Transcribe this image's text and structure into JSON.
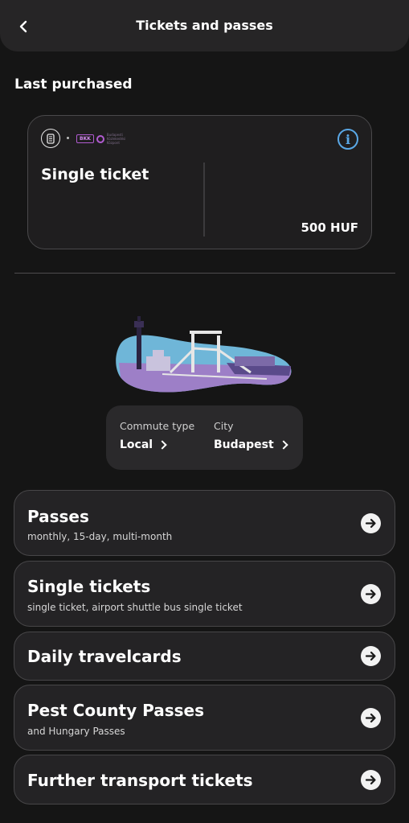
{
  "header": {
    "title": "Tickets and passes"
  },
  "last_purchased": {
    "section_title": "Last purchased",
    "ticket_name": "Single ticket",
    "price": "500 HUF",
    "operator_logo_text": "BKK",
    "operator_logo_subtext": "Budapesti Közlekedési Központ"
  },
  "selector": {
    "commute_label": "Commute type",
    "commute_value": "Local",
    "city_label": "City",
    "city_value": "Budapest"
  },
  "menu": [
    {
      "title": "Passes",
      "subtitle": "monthly, 15-day, multi-month"
    },
    {
      "title": "Single tickets",
      "subtitle": "single ticket, airport shuttle bus single ticket"
    },
    {
      "title": "Daily travelcards",
      "subtitle": ""
    },
    {
      "title": "Pest County Passes",
      "subtitle": "and Hungary Passes"
    },
    {
      "title": "Further transport tickets",
      "subtitle": ""
    }
  ],
  "colors": {
    "info_accent": "#5aa8e6",
    "bkk_purple": "#b05bd0",
    "background": "#151515"
  }
}
